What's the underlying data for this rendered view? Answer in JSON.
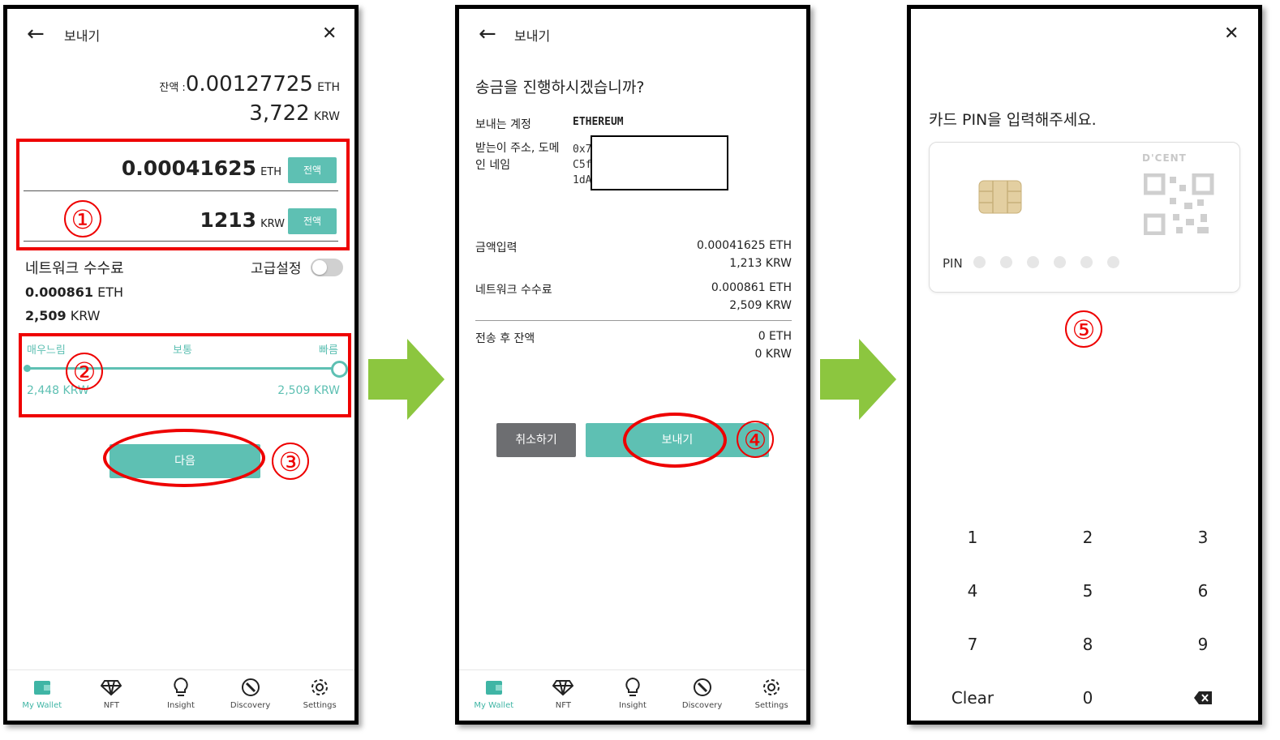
{
  "colors": {
    "teal": "#5ec0b3",
    "annotation_red": "#e00000",
    "arrow_green": "#8cc63f",
    "gray_button": "#6d6e71"
  },
  "screen1": {
    "title": "보내기",
    "balance_label": "잔액 :",
    "balance_eth": "0.00127725",
    "balance_eth_unit": "ETH",
    "balance_krw": "3,722",
    "balance_krw_unit": "KRW",
    "amount_eth": "0.00041625",
    "amount_eth_unit": "ETH",
    "amount_krw": "1213",
    "amount_krw_unit": "KRW",
    "all_button": "전액",
    "fee_label": "네트워크 수수료",
    "advanced_label": "고급설정",
    "advanced_on": false,
    "fee_eth": "0.000861",
    "fee_eth_unit": "ETH",
    "fee_krw": "2,509",
    "fee_krw_unit": "KRW",
    "speed_slow": "매우느림",
    "speed_normal": "보통",
    "speed_fast": "빠름",
    "speed_min": "2,448 KRW",
    "speed_max": "2,509 KRW",
    "speed_level": 1.0,
    "next_button": "다음",
    "annotations": [
      "①",
      "②",
      "③"
    ]
  },
  "screen2": {
    "title": "보내기",
    "question": "송금을 진행하시겠습니까?",
    "from_label": "보내는 계정",
    "from_value": "ETHEREUM",
    "to_label": "받는이 주소, 도메인 네임",
    "to_value_lines": [
      "0x7",
      "C5f",
      "1dA"
    ],
    "amount_label": "금액입력",
    "amount_eth": "0.00041625 ETH",
    "amount_krw": "1,213 KRW",
    "fee_label": "네트워크 수수료",
    "fee_eth": "0.000861 ETH",
    "fee_krw": "2,509 KRW",
    "remain_label": "전송 후 잔액",
    "remain_eth": "0 ETH",
    "remain_krw": "0 KRW",
    "cancel_button": "취소하기",
    "send_button": "보내기",
    "annotation": "④"
  },
  "screen3": {
    "prompt": "카드 PIN을 입력해주세요.",
    "card_brand": "D'CENT",
    "pin_label": "PIN",
    "pin_digits_entered": 0,
    "annotation": "⑤",
    "keypad": [
      "1",
      "2",
      "3",
      "4",
      "5",
      "6",
      "7",
      "8",
      "9",
      "Clear",
      "0",
      "backspace-icon"
    ]
  },
  "nav": {
    "items": [
      {
        "label": "My Wallet",
        "icon": "wallet-icon"
      },
      {
        "label": "NFT",
        "icon": "diamond-icon"
      },
      {
        "label": "Insight",
        "icon": "lightbulb-icon"
      },
      {
        "label": "Discovery",
        "icon": "compass-icon"
      },
      {
        "label": "Settings",
        "icon": "gear-icon"
      }
    ]
  }
}
